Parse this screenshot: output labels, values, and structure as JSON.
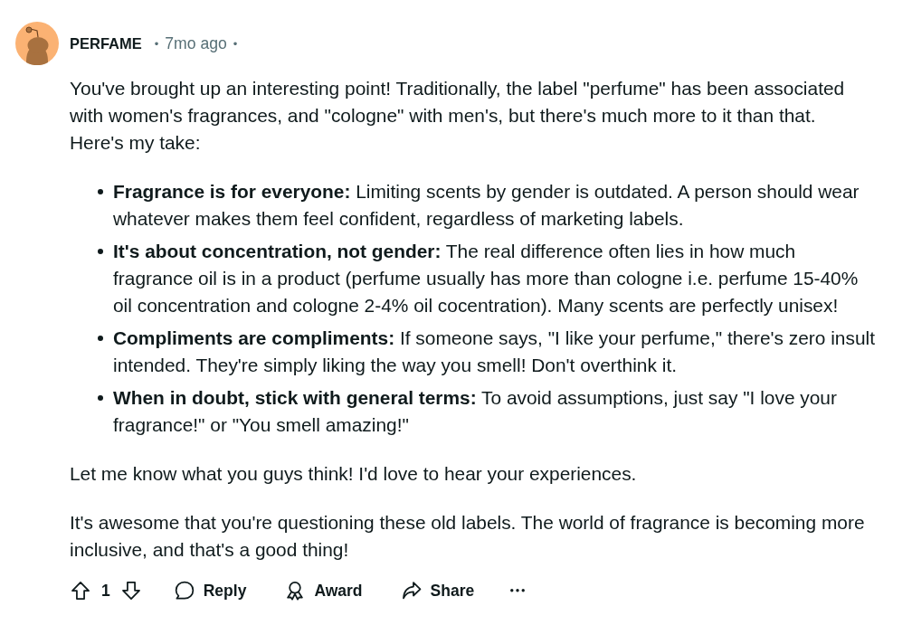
{
  "comment": {
    "author": "PERFAME",
    "meta": [
      {
        "kind": "separator",
        "text": "•"
      },
      {
        "kind": "time",
        "text": "7mo ago"
      },
      {
        "kind": "separator",
        "text": "•"
      }
    ],
    "body": [
      {
        "kind": "paragraph",
        "text": "You've brought up an interesting point! Traditionally, the label \"perfume\" has been associated with women's fragrances, and \"cologne\" with men's, but there's much more to it than that.\nHere's my take:"
      },
      {
        "kind": "list",
        "items": [
          "**Fragrance is for everyone:** Limiting scents by gender is outdated. A person should wear whatever makes them feel confident, regardless of marketing labels.",
          "**It's about concentration, not gender:** The real difference often lies in how much fragrance oil is in a product (perfume usually has more than cologne i.e. perfume 15-40% oil concentration and cologne 2-4% oil cocentration). Many scents are perfectly unisex!",
          "**Compliments are compliments:** If someone says, \"I like your perfume,\" there's zero insult intended. They're simply liking the way you smell! Don't overthink it.",
          "**When in doubt, stick with general terms:** To avoid assumptions, just say \"I love your fragrance!\" or \"You smell amazing!\""
        ]
      },
      {
        "kind": "paragraph",
        "text": "Let me know what you guys think! I'd love to hear your experiences."
      },
      {
        "kind": "paragraph",
        "text": "It's awesome that you're questioning these old labels. The world of fragrance is becoming more inclusive, and that's a good thing!"
      }
    ],
    "actions": {
      "vote_count": "1",
      "buttons": [
        {
          "kind": "reply",
          "label": "Reply"
        },
        {
          "kind": "award",
          "label": "Award"
        },
        {
          "kind": "share",
          "label": "Share"
        },
        {
          "kind": "more"
        }
      ]
    }
  }
}
